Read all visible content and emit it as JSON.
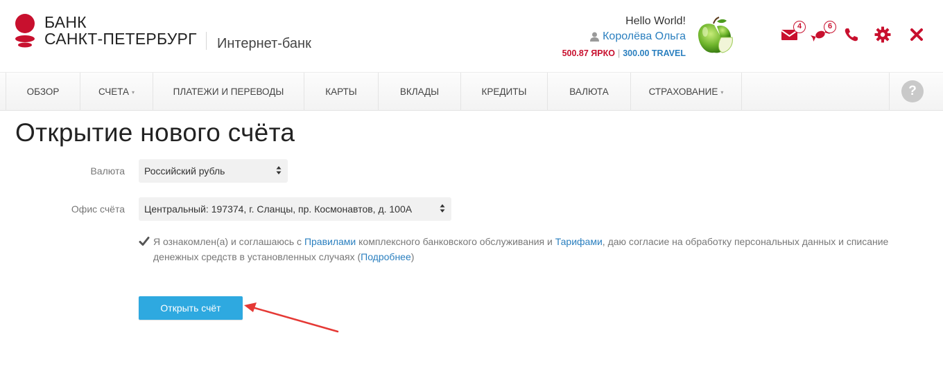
{
  "header": {
    "brand_line1": "БАНК",
    "brand_line2": "САНКТ-ПЕТЕРБУРГ",
    "brand_sub": "Интернет-банк",
    "greeting": "Hello World!",
    "user_name": "Королёва Ольга",
    "balance_primary": "500.87 ЯРКО",
    "balance_separator": "|",
    "balance_secondary": "300.00 TRAVEL",
    "messages_badge": "4",
    "bonus_badge": "6",
    "icons": [
      "envelope-icon",
      "candy-icon",
      "phone-icon",
      "gear-icon",
      "close-icon"
    ]
  },
  "nav": {
    "items": [
      {
        "label": "ОБЗОР",
        "dropdown": false
      },
      {
        "label": "СЧЕТА",
        "dropdown": true
      },
      {
        "label": "ПЛАТЕЖИ И ПЕРЕВОДЫ",
        "dropdown": false
      },
      {
        "label": "КАРТЫ",
        "dropdown": false
      },
      {
        "label": "ВКЛАДЫ",
        "dropdown": false
      },
      {
        "label": "КРЕДИТЫ",
        "dropdown": false
      },
      {
        "label": "ВАЛЮТА",
        "dropdown": false
      },
      {
        "label": "СТРАХОВАНИЕ",
        "dropdown": true
      }
    ],
    "caret": "▾",
    "help": "?"
  },
  "main": {
    "title": "Открытие нового счёта",
    "currency_label": "Валюта",
    "currency_value": "Российский рубль",
    "office_label": "Офис счёта",
    "office_value": "Центральный: 197374, г. Сланцы, пр. Космонавтов, д. 100А",
    "agreement": {
      "checked": true,
      "part1": "Я ознакомлен(а) и соглашаюсь с ",
      "link_rules": "Правилами",
      "part2": " комплексного банковского обслуживания и ",
      "link_tariffs": "Тарифами",
      "part3": ", даю согласие на обработку персональных данных и списание денежных средств в установленных случаях (",
      "link_more": "Подробнее",
      "part4": ")"
    },
    "submit_label": "Открыть счёт"
  },
  "colors": {
    "brand_red": "#c8102e",
    "link_blue": "#2a7fbf",
    "button_blue": "#2ea9e0",
    "annotation_red": "#e53935"
  }
}
